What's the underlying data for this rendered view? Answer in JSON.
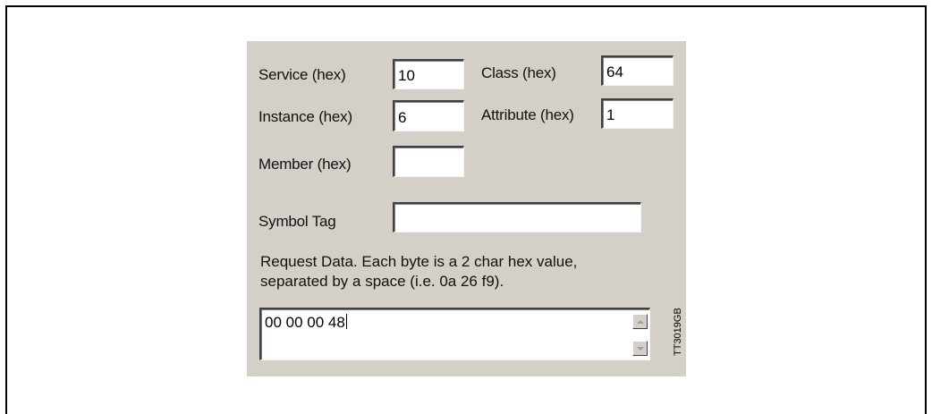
{
  "form": {
    "service_label": "Service (hex)",
    "service_value": "10",
    "class_label": "Class (hex)",
    "class_value": "64",
    "instance_label": "Instance (hex)",
    "instance_value": "6",
    "attribute_label": "Attribute (hex)",
    "attribute_value": "1",
    "member_label": "Member (hex)",
    "member_value": "",
    "symbol_tag_label": "Symbol Tag",
    "symbol_tag_value": "",
    "request_note_line1": "Request Data. Each byte is a 2 char hex value,",
    "request_note_line2": "separated by a space (i.e. 0a 26 f9).",
    "request_data_value": "00 00 00 48"
  },
  "figure_code": "TT3019GB",
  "icons": {
    "scroll_up": "scroll-up-arrow",
    "scroll_down": "scroll-down-arrow"
  },
  "colors": {
    "panel_bg": "#d4d0c8",
    "field_bg": "#ffffff"
  }
}
